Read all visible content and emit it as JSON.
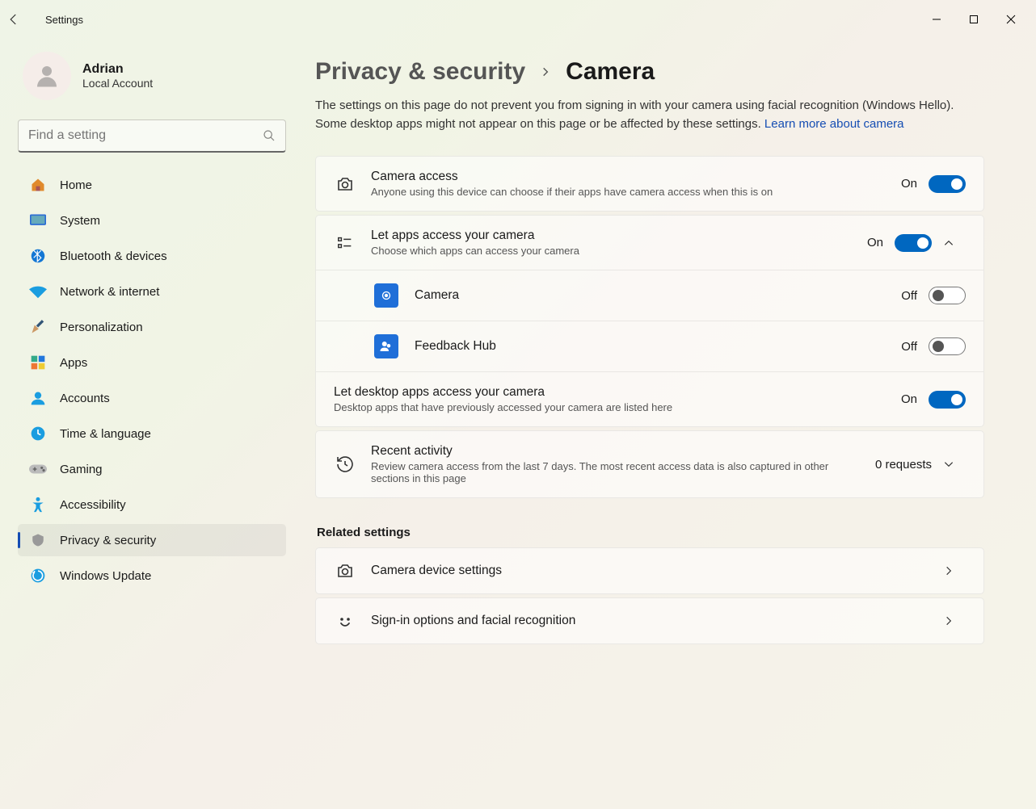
{
  "title": "Settings",
  "user": {
    "name": "Adrian",
    "sub": "Local Account"
  },
  "search": {
    "placeholder": "Find a setting"
  },
  "nav": [
    {
      "id": "home",
      "label": "Home"
    },
    {
      "id": "system",
      "label": "System"
    },
    {
      "id": "bluetooth",
      "label": "Bluetooth & devices"
    },
    {
      "id": "network",
      "label": "Network & internet"
    },
    {
      "id": "personalization",
      "label": "Personalization"
    },
    {
      "id": "apps",
      "label": "Apps"
    },
    {
      "id": "accounts",
      "label": "Accounts"
    },
    {
      "id": "time",
      "label": "Time & language"
    },
    {
      "id": "gaming",
      "label": "Gaming"
    },
    {
      "id": "accessibility",
      "label": "Accessibility"
    },
    {
      "id": "privacy",
      "label": "Privacy & security"
    },
    {
      "id": "update",
      "label": "Windows Update"
    }
  ],
  "nav_active": "privacy",
  "breadcrumb": {
    "parent": "Privacy & security",
    "current": "Camera"
  },
  "description": "The settings on this page do not prevent you from signing in with your camera using facial recognition (Windows Hello). Some desktop apps might not appear on this page or be affected by these settings.  ",
  "description_link": "Learn more about camera",
  "camera_access": {
    "title": "Camera access",
    "sub": "Anyone using this device can choose if their apps have camera access when this is on",
    "state": "On",
    "on": true
  },
  "apps_access": {
    "title": "Let apps access your camera",
    "sub": "Choose which apps can access your camera",
    "state": "On",
    "on": true,
    "apps": [
      {
        "name": "Camera",
        "state": "Off",
        "on": false,
        "iconColor": "#1f6fd8"
      },
      {
        "name": "Feedback Hub",
        "state": "Off",
        "on": false,
        "iconColor": "#1f6fd8"
      }
    ],
    "desktop": {
      "title": "Let desktop apps access your camera",
      "sub": "Desktop apps that have previously accessed your camera are listed here",
      "state": "On",
      "on": true
    }
  },
  "recent": {
    "title": "Recent activity",
    "sub": "Review camera access from the last 7 days. The most recent access data is also captured in other sections in this page",
    "badge": "0 requests"
  },
  "related_heading": "Related settings",
  "related": [
    {
      "title": "Camera device settings",
      "icon": "camera"
    },
    {
      "title": "Sign-in options and facial recognition",
      "icon": "face"
    }
  ]
}
